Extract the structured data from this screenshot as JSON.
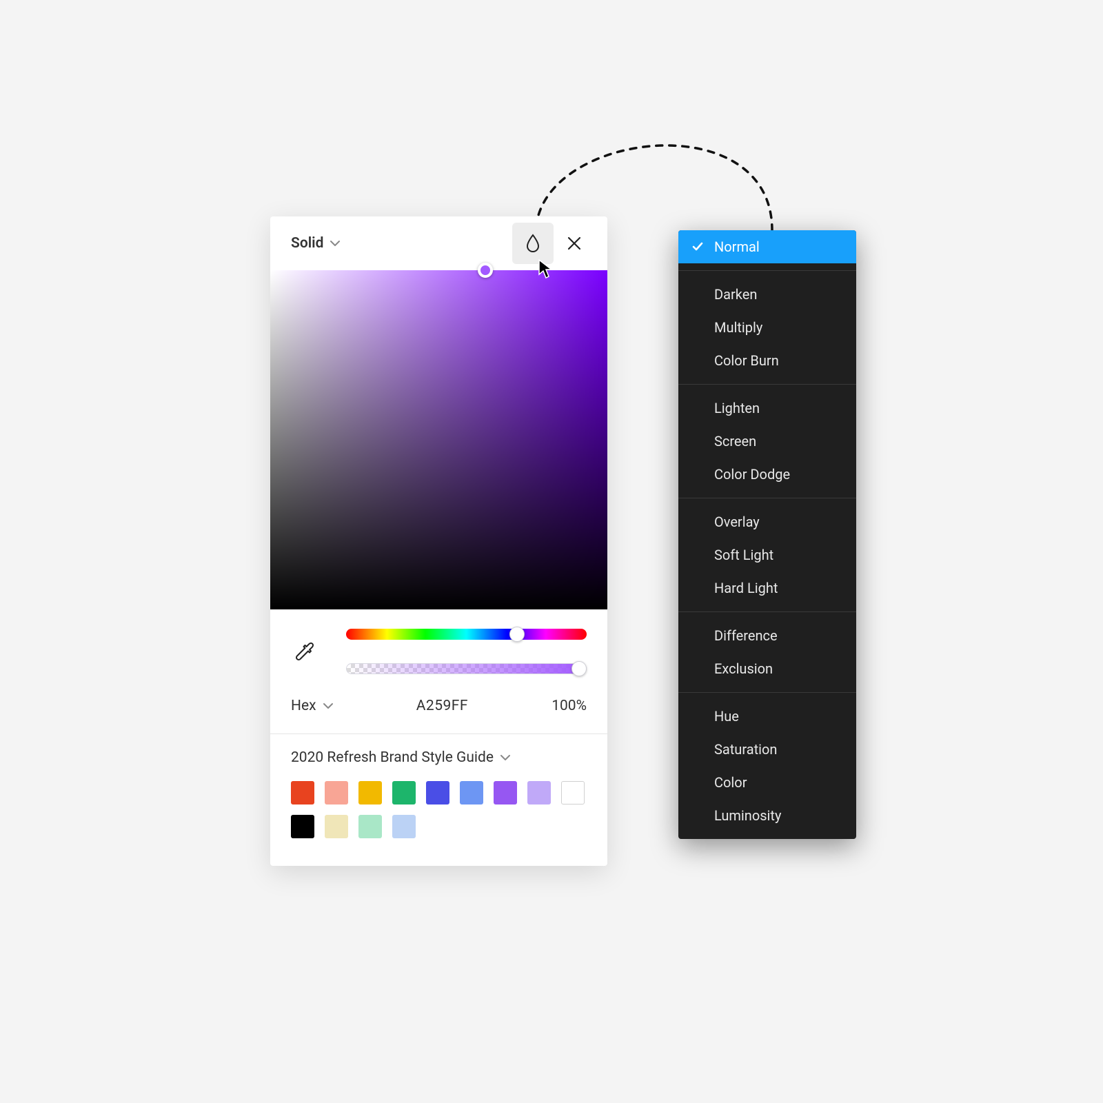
{
  "picker": {
    "fill_type_label": "Solid",
    "hex_format_label": "Hex",
    "hex_value": "A259FF",
    "opacity_value": "100%",
    "palette_title": "2020 Refresh Brand Style Guide",
    "swatches": [
      {
        "hex": "#E8431F"
      },
      {
        "hex": "#F8A595"
      },
      {
        "hex": "#F2B900"
      },
      {
        "hex": "#1DB56B"
      },
      {
        "hex": "#4A4EE6"
      },
      {
        "hex": "#6D96F3"
      },
      {
        "hex": "#9657F2"
      },
      {
        "hex": "#C0A9F8"
      },
      {
        "hex": "#FFFFFF",
        "bordered": true
      },
      {
        "hex": "#000000"
      },
      {
        "hex": "#F0E6B8"
      },
      {
        "hex": "#A9E7C7"
      },
      {
        "hex": "#BBD2F5"
      }
    ],
    "selected_color": "#A259FF"
  },
  "blend_modes": {
    "selected": "Normal",
    "groups": [
      [
        "Normal"
      ],
      [
        "Darken",
        "Multiply",
        "Color Burn"
      ],
      [
        "Lighten",
        "Screen",
        "Color Dodge"
      ],
      [
        "Overlay",
        "Soft Light",
        "Hard Light"
      ],
      [
        "Difference",
        "Exclusion"
      ],
      [
        "Hue",
        "Saturation",
        "Color",
        "Luminosity"
      ]
    ]
  }
}
